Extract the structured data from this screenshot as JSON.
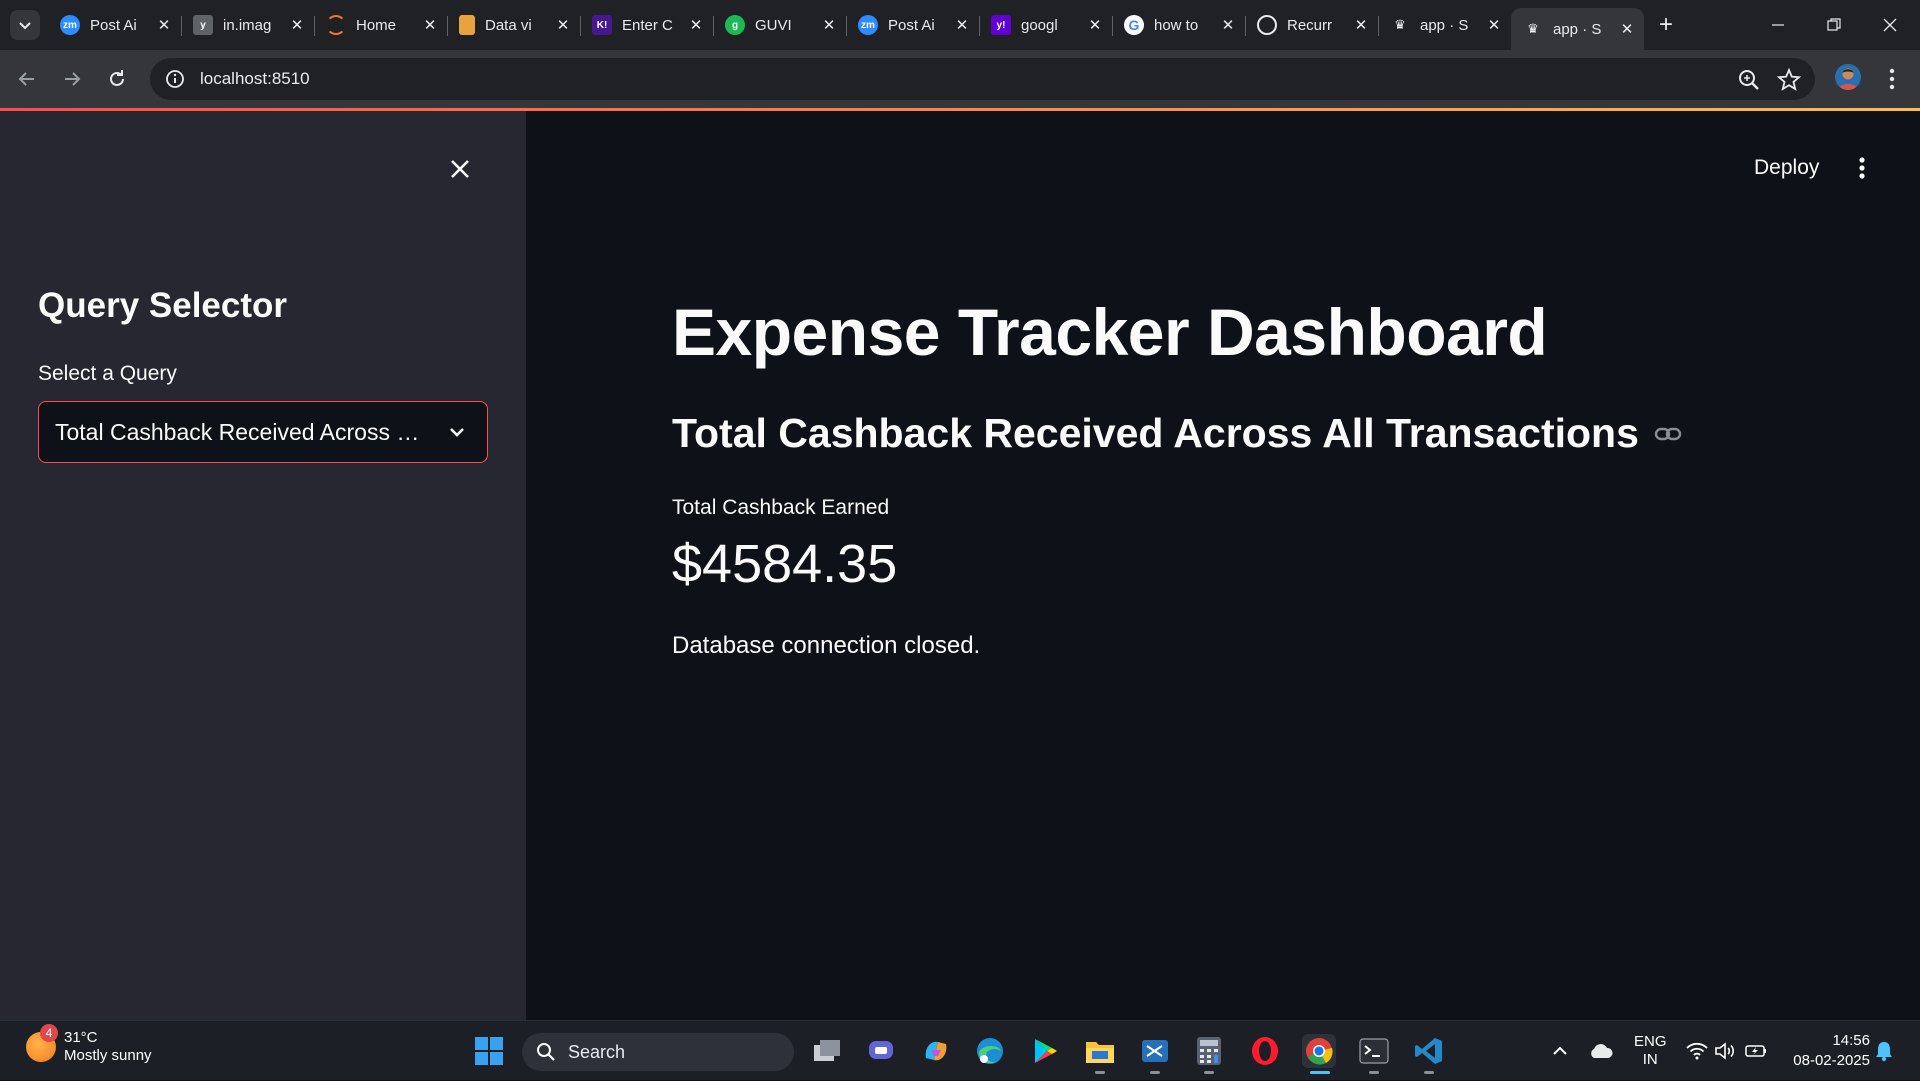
{
  "browser": {
    "tabs": [
      {
        "title": "Post Ai",
        "icon": "zoom-icon",
        "color": "#2d8cff"
      },
      {
        "title": "in.imag",
        "icon": "yahoo-y-icon",
        "color": "#5f6368"
      },
      {
        "title": "Home",
        "icon": "jupyter-icon",
        "color": "#f37726"
      },
      {
        "title": "Data vi",
        "icon": "book-icon",
        "color": "#e8a33d"
      },
      {
        "title": "Enter C",
        "icon": "kahoot-icon",
        "color": "#46178f"
      },
      {
        "title": "GUVI",
        "icon": "guvi-icon",
        "color": "#1db954"
      },
      {
        "title": "Post Ai",
        "icon": "zoom-icon",
        "color": "#2d8cff"
      },
      {
        "title": "googl",
        "icon": "yahoo-icon",
        "color": "#6001d2"
      },
      {
        "title": "how to",
        "icon": "google-icon",
        "color": "#ffffff"
      },
      {
        "title": "Recurr",
        "icon": "openai-icon",
        "color": "#ffffff"
      },
      {
        "title": "app · S",
        "icon": "streamlit-icon",
        "color": "#ffffff"
      },
      {
        "title": "app · S",
        "icon": "streamlit-icon",
        "color": "#ffffff"
      }
    ],
    "active_tab_index": 11,
    "url": "localhost:8510"
  },
  "app": {
    "deploy_label": "Deploy",
    "sidebar": {
      "title": "Query Selector",
      "select_label": "Select a Query",
      "selected_query": "Total Cashback Received Across All Transactions"
    },
    "main": {
      "title": "Expense Tracker Dashboard",
      "subheader": "Total Cashback Received Across All Transactions",
      "metric_label": "Total Cashback Earned",
      "metric_value": "$4584.35",
      "status_text": "Database connection closed."
    },
    "accent_color": "#ff4b4b"
  },
  "taskbar": {
    "weather_temp": "31°C",
    "weather_desc": "Mostly sunny",
    "weather_badge": "4",
    "search_label": "Search",
    "lang_line1": "ENG",
    "lang_line2": "IN",
    "time": "14:56",
    "date": "08-02-2025"
  }
}
